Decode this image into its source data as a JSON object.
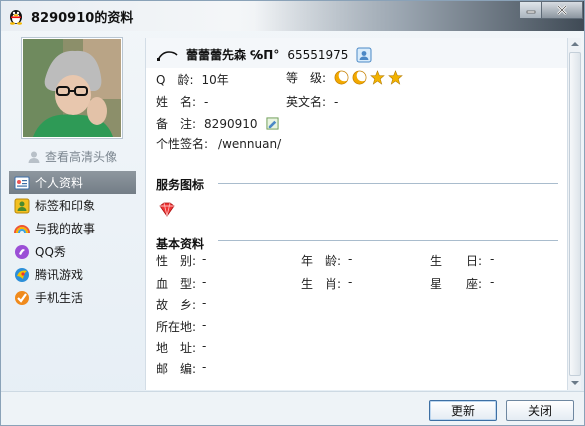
{
  "window": {
    "title": "8290910的资料"
  },
  "profile": {
    "view_hd_avatar": "查看高清头像",
    "nickname": "蕾蕾蕾先森 ℅Π°",
    "qq_number": "65551975",
    "fields": {
      "qage_label": "Q　龄:",
      "qage_value": "10年",
      "level_label": "等　级:",
      "name_label": "姓　名:",
      "name_value": "-",
      "english_name_label": "英文名:",
      "english_name_value": "-",
      "remark_label": "备　注:",
      "remark_value": "8290910",
      "signature_label": "个性签名:",
      "signature_value": "/wennuan/"
    }
  },
  "sidebar": {
    "items": [
      {
        "label": "个人资料",
        "icon": "profile-card-icon",
        "active": true
      },
      {
        "label": "标签和印象",
        "icon": "tag-icon",
        "active": false
      },
      {
        "label": "与我的故事",
        "icon": "rainbow-icon",
        "active": false
      },
      {
        "label": "QQ秀",
        "icon": "qqshow-icon",
        "active": false
      },
      {
        "label": "腾讯游戏",
        "icon": "games-icon",
        "active": false
      },
      {
        "label": "手机生活",
        "icon": "mobile-check-icon",
        "active": false
      }
    ]
  },
  "service_section": {
    "title": "服务图标"
  },
  "basic_section": {
    "title": "基本资料",
    "rows": [
      [
        {
          "label": "性　别:",
          "value": "-"
        },
        {
          "label": "年　龄:",
          "value": "-"
        },
        {
          "label": "生　　日:",
          "value": "-"
        }
      ],
      [
        {
          "label": "血　型:",
          "value": "-"
        },
        {
          "label": "生　肖:",
          "value": "-"
        },
        {
          "label": "星　　座:",
          "value": "-"
        }
      ],
      [
        {
          "label": "故　乡:",
          "value": "-"
        }
      ],
      [
        {
          "label": "所在地:",
          "value": "-"
        }
      ],
      [
        {
          "label": "地　址:",
          "value": "-"
        }
      ],
      [
        {
          "label": "邮　编:",
          "value": "-"
        }
      ]
    ]
  },
  "footer": {
    "refresh_label": "更新",
    "close_label": "关闭"
  },
  "colors": {
    "nav_active": "#7f8992",
    "accent_blue": "#3d6fa3",
    "level_moon": "#f2a900",
    "level_star": "#f2b200"
  }
}
